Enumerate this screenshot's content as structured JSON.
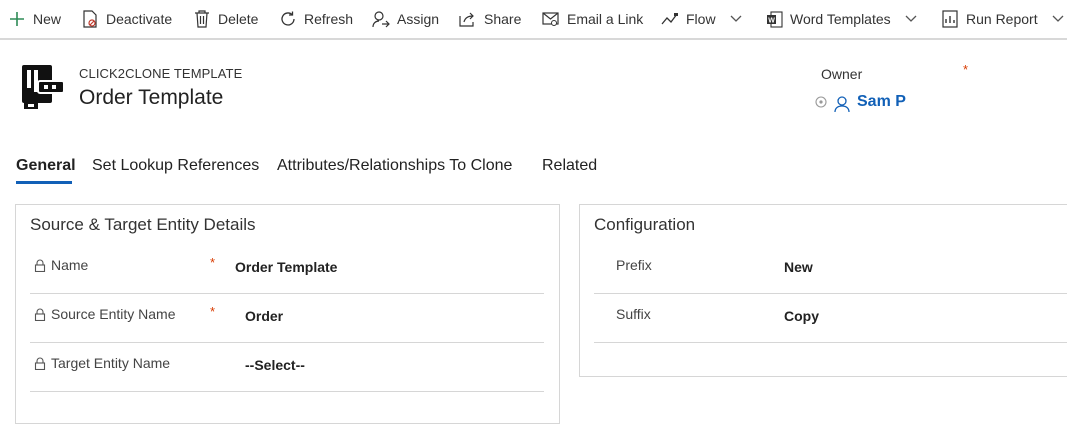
{
  "colors": {
    "accent": "#1160b7",
    "required": "#d83b01",
    "new_plus": "#2e8b57"
  },
  "command_bar": {
    "new": "New",
    "deactivate": "Deactivate",
    "delete": "Delete",
    "refresh": "Refresh",
    "assign": "Assign",
    "share": "Share",
    "email_link": "Email a Link",
    "flow": "Flow",
    "word_templates": "Word Templates",
    "run_report": "Run Report"
  },
  "header": {
    "entity_type": "CLICK2CLONE TEMPLATE",
    "title": "Order Template",
    "owner_label": "Owner",
    "owner_required": "*",
    "owner_name": "Sam P"
  },
  "tabs": [
    "General",
    "Set Lookup References",
    "Attributes/Relationships To Clone",
    "Related"
  ],
  "source_section": {
    "title": "Source & Target Entity Details",
    "fields": [
      {
        "label": "Name",
        "required": "*",
        "value": "Order Template"
      },
      {
        "label": "Source Entity Name",
        "required": "*",
        "value": "Order"
      },
      {
        "label": "Target Entity Name",
        "required": "",
        "value": "--Select--"
      }
    ]
  },
  "config_section": {
    "title": "Configuration",
    "fields": [
      {
        "label": "Prefix",
        "value": "New"
      },
      {
        "label": "Suffix",
        "value": "Copy"
      }
    ]
  }
}
